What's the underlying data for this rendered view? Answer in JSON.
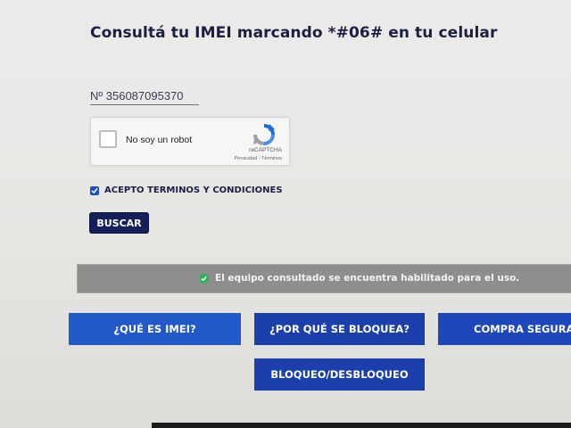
{
  "page": {
    "title": "Consultá tu IMEI marcando *#06# en tu celular"
  },
  "imei_input": {
    "value": "Nº 356087095370"
  },
  "captcha": {
    "label": "No soy un robot",
    "brand": "reCAPTCHA",
    "links": "Privacidad - Términos",
    "checked": false
  },
  "terms": {
    "label": "ACEPTO TERMINOS Y CONDICIONES",
    "checked": true
  },
  "search_button": {
    "label": "BUSCAR"
  },
  "result": {
    "message": "El equipo consultado se encuentra habilitado para el uso.",
    "status_color": "#2fb35a"
  },
  "nav": {
    "items": [
      {
        "label": "¿QUÉ ES IMEI?"
      },
      {
        "label": "¿POR QUÉ SE BLOQUEA?"
      },
      {
        "label": "COMPRA SEGURA"
      },
      {
        "label": "BLOQUEO/DESBLOQUEO"
      }
    ]
  },
  "colors": {
    "primary_button": "#1b4fc2",
    "dark_button": "#15205a",
    "result_bar": "#8c8f8b",
    "title_text": "#1c1f44"
  }
}
